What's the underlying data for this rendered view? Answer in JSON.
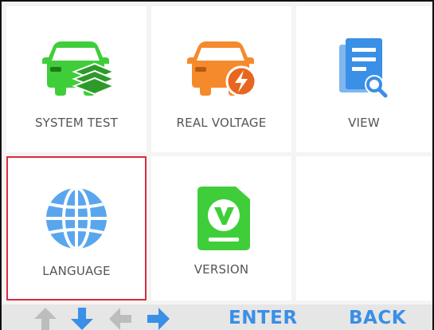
{
  "menu": {
    "items": [
      {
        "label": "SYSTEM TEST",
        "icon": "car-layers-icon"
      },
      {
        "label": "REAL VOLTAGE",
        "icon": "car-voltage-icon"
      },
      {
        "label": "VIEW",
        "icon": "document-search-icon"
      },
      {
        "label": "LANGUAGE",
        "icon": "globe-icon",
        "selected": true
      },
      {
        "label": "VERSION",
        "icon": "version-v-icon"
      }
    ]
  },
  "footer": {
    "enter_label": "ENTER",
    "back_label": "BACK"
  },
  "colors": {
    "green": "#3fce3a",
    "orange": "#f58a2c",
    "blue": "#3a8fe6",
    "selection": "#d92c3d"
  }
}
